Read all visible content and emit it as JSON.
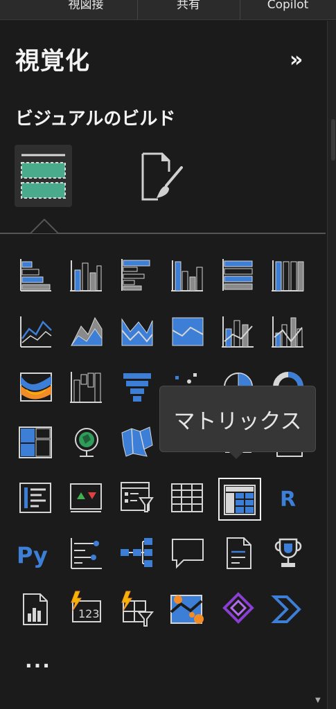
{
  "top_tabs": [
    {
      "label": "視図接"
    },
    {
      "label": "共有"
    },
    {
      "label": "Copilot"
    }
  ],
  "pane": {
    "title": "視覚化",
    "collapse_glyph": "»",
    "subtitle": "ビジュアルのビルド",
    "more_glyph": "..."
  },
  "tooltip": {
    "text": "マトリックス"
  },
  "visuals": [
    {
      "icon": "stacked-bar-chart-icon"
    },
    {
      "icon": "stacked-column-chart-icon"
    },
    {
      "icon": "clustered-bar-chart-icon"
    },
    {
      "icon": "clustered-column-chart-icon"
    },
    {
      "icon": "100-stacked-bar-chart-icon"
    },
    {
      "icon": "100-stacked-column-chart-icon"
    },
    {
      "icon": "line-chart-icon"
    },
    {
      "icon": "area-chart-icon"
    },
    {
      "icon": "stacked-area-chart-icon"
    },
    {
      "icon": "100-stacked-area-chart-icon"
    },
    {
      "icon": "line-and-stacked-column-chart-icon"
    },
    {
      "icon": "line-and-clustered-column-chart-icon"
    },
    {
      "icon": "ribbon-chart-icon"
    },
    {
      "icon": "waterfall-chart-icon"
    },
    {
      "icon": "funnel-chart-icon"
    },
    {
      "icon": "scatter-chart-icon"
    },
    {
      "icon": "pie-chart-icon"
    },
    {
      "icon": "donut-chart-icon"
    },
    {
      "icon": "treemap-icon"
    },
    {
      "icon": "map-icon"
    },
    {
      "icon": "filled-map-icon"
    },
    {
      "icon": "azure-map-icon"
    },
    {
      "icon": "shape-map-icon"
    },
    {
      "icon": "gauge-icon"
    },
    {
      "icon": "multi-row-card-icon"
    },
    {
      "icon": "kpi-icon"
    },
    {
      "icon": "slicer-icon"
    },
    {
      "icon": "table-icon"
    },
    {
      "icon": "matrix-icon"
    },
    {
      "icon": "r-script-visual-icon"
    },
    {
      "icon": "python-visual-icon"
    },
    {
      "icon": "key-influencers-icon"
    },
    {
      "icon": "decomposition-tree-icon"
    },
    {
      "icon": "q-and-a-icon"
    },
    {
      "icon": "narrative-icon"
    },
    {
      "icon": "goals-icon"
    },
    {
      "icon": "paginated-report-icon"
    },
    {
      "icon": "card-icon"
    },
    {
      "icon": "new-slicer-icon"
    },
    {
      "icon": "arcgis-map-icon"
    },
    {
      "icon": "power-apps-icon"
    },
    {
      "icon": "power-automate-icon"
    }
  ],
  "colors": {
    "background": "#1b1b1b",
    "accent_blue": "#3d7fd6",
    "accent_green": "#4aaa8c",
    "tooltip_bg": "#363636"
  }
}
